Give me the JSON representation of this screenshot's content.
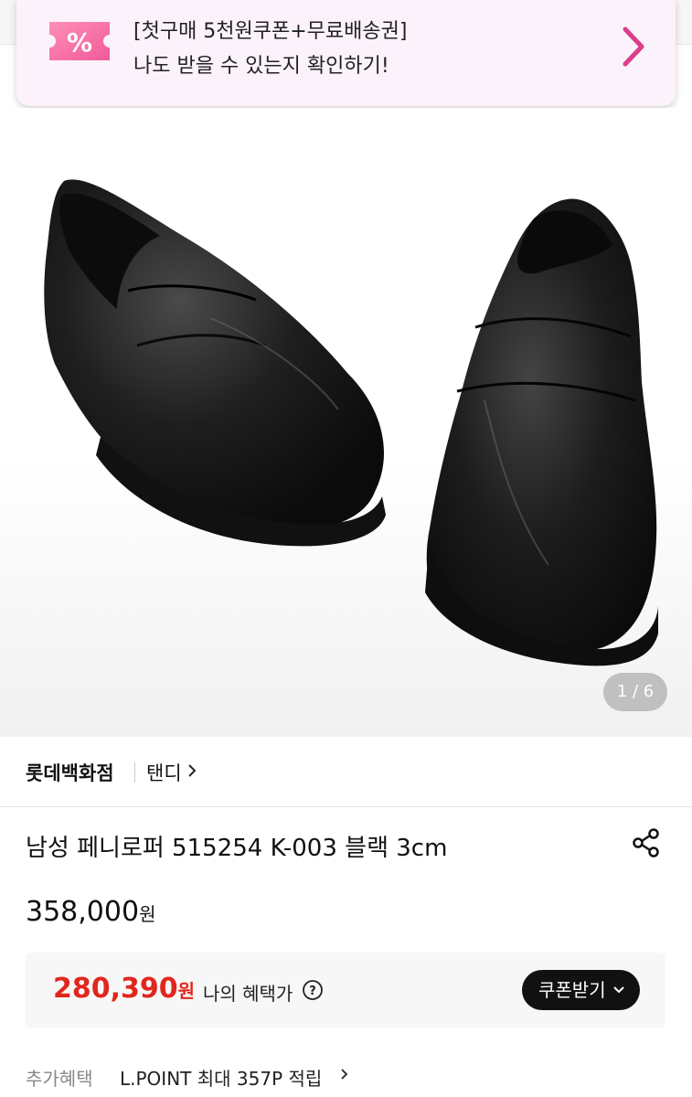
{
  "promo": {
    "line1": "[첫구매 5천원쿠폰+무료배송권]",
    "line2": "나도 받을 수 있는지 확인하기!",
    "icon": "percent-coupon-icon",
    "arrow_icon": "chevron-right-icon",
    "accent_color": "#e0458f"
  },
  "gallery": {
    "pager": "1 / 6"
  },
  "brand": {
    "store": "롯데백화점",
    "name": "탠디"
  },
  "product": {
    "title": "남성 페니로퍼 515254 K-003 블랙 3cm",
    "price": "358,000",
    "price_unit": "원"
  },
  "benefit": {
    "price": "280,390",
    "price_unit": "원",
    "label": "나의 혜택가",
    "coupon_button": "쿠폰받기",
    "sale_color": "#e1261c"
  },
  "extra": {
    "label": "추가혜택",
    "value": "L.POINT 최대 357P 적립"
  }
}
